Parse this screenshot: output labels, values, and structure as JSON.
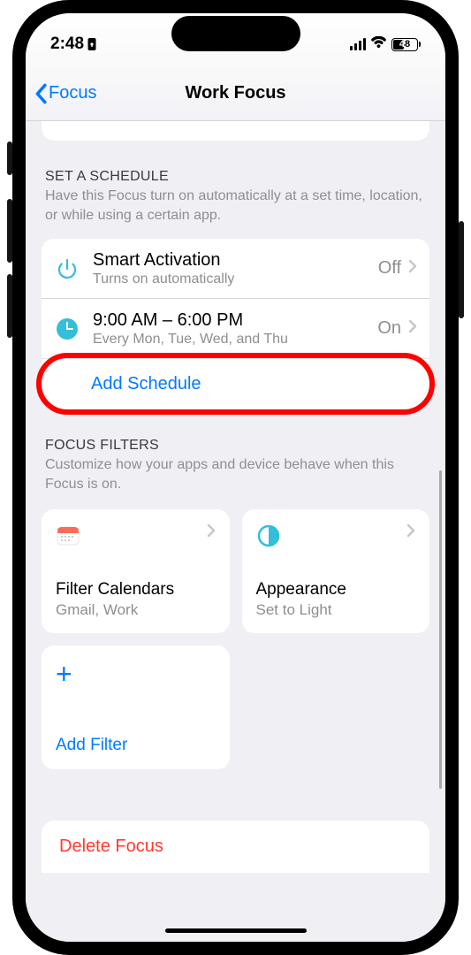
{
  "status_bar": {
    "time": "2:48",
    "battery_percent": "48"
  },
  "nav": {
    "back_label": "Focus",
    "title": "Work Focus"
  },
  "schedule_section": {
    "title": "SET A SCHEDULE",
    "desc": "Have this Focus turn on automatically at a set time, location, or while using a certain app.",
    "smart_activation": {
      "title": "Smart Activation",
      "sub": "Turns on automatically",
      "status": "Off"
    },
    "time_schedule": {
      "title": "9:00 AM – 6:00 PM",
      "sub": "Every Mon, Tue, Wed, and Thu",
      "status": "On"
    },
    "add_label": "Add Schedule"
  },
  "filters_section": {
    "title": "FOCUS FILTERS",
    "desc": "Customize how your apps and device behave when this Focus is on.",
    "tiles": {
      "calendar": {
        "title": "Filter Calendars",
        "sub": "Gmail, Work"
      },
      "appearance": {
        "title": "Appearance",
        "sub": "Set to Light"
      },
      "add": {
        "title": "Add Filter"
      }
    }
  },
  "delete_label": "Delete Focus"
}
